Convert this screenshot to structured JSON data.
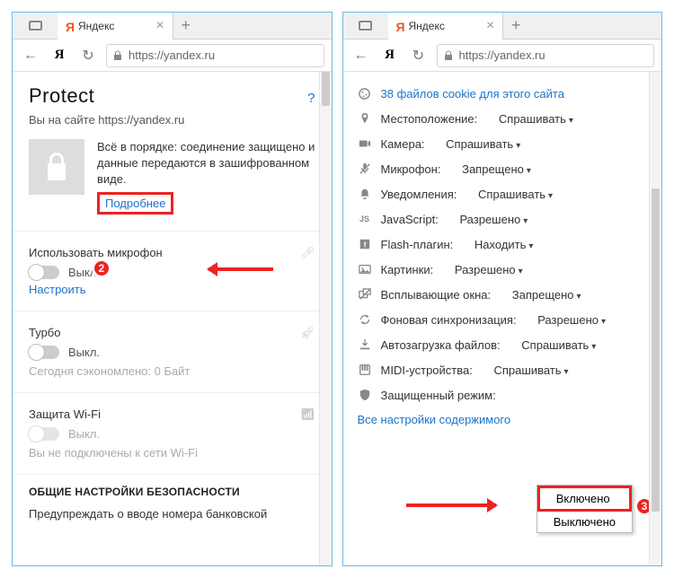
{
  "tab_title": "Яндекс",
  "url_text": "https://yandex.ru",
  "left": {
    "heading": "Protect",
    "help": "?",
    "you_on": "Вы на сайте https://yandex.ru",
    "ok_text": "Всё в порядке: соединение защищено и данные передаются в зашифрованном виде.",
    "more": "Подробнее",
    "mic_label": "Использовать микрофон",
    "off": "Выкл.",
    "configure": "Настроить",
    "turbo_label": "Турбо",
    "saved": "Сегодня сэкономлено: 0 Байт",
    "wifi_label": "Защита Wi-Fi",
    "wifi_msg": "Вы не подключены к сети Wi-Fi",
    "sec_heading": "ОБЩИЕ НАСТРОЙКИ БЕЗОПАСНОСТИ",
    "bank_notice": "Предупреждать о вводе номера банковской",
    "badge2": "2"
  },
  "right": {
    "cookies": "38 файлов cookie для этого сайта",
    "items": [
      {
        "icon": "pin",
        "label": "Местоположение:",
        "val": "Спрашивать"
      },
      {
        "icon": "cam",
        "label": "Камера:",
        "val": "Спрашивать"
      },
      {
        "icon": "mic",
        "label": "Микрофон:",
        "val": "Запрещено"
      },
      {
        "icon": "bell",
        "label": "Уведомления:",
        "val": "Спрашивать"
      },
      {
        "icon": "js",
        "label": "JavaScript:",
        "val": "Разрешено"
      },
      {
        "icon": "flash",
        "label": "Flash-плагин:",
        "val": "Находить"
      },
      {
        "icon": "img",
        "label": "Картинки:",
        "val": "Разрешено"
      },
      {
        "icon": "popup",
        "label": "Всплывающие окна:",
        "val": "Запрещено"
      },
      {
        "icon": "sync",
        "label": "Фоновая синхронизация:",
        "val": "Разрешено"
      },
      {
        "icon": "dl",
        "label": "Автозагрузка файлов:",
        "val": "Спрашивать"
      },
      {
        "icon": "midi",
        "label": "MIDI-устройства:",
        "val": "Спрашивать"
      },
      {
        "icon": "shield",
        "label": "Защищенный режим:",
        "val": ""
      }
    ],
    "dd_on": "Включено",
    "dd_off": "Выключено",
    "all_settings": "Все настройки содержимого",
    "badge3": "3"
  }
}
